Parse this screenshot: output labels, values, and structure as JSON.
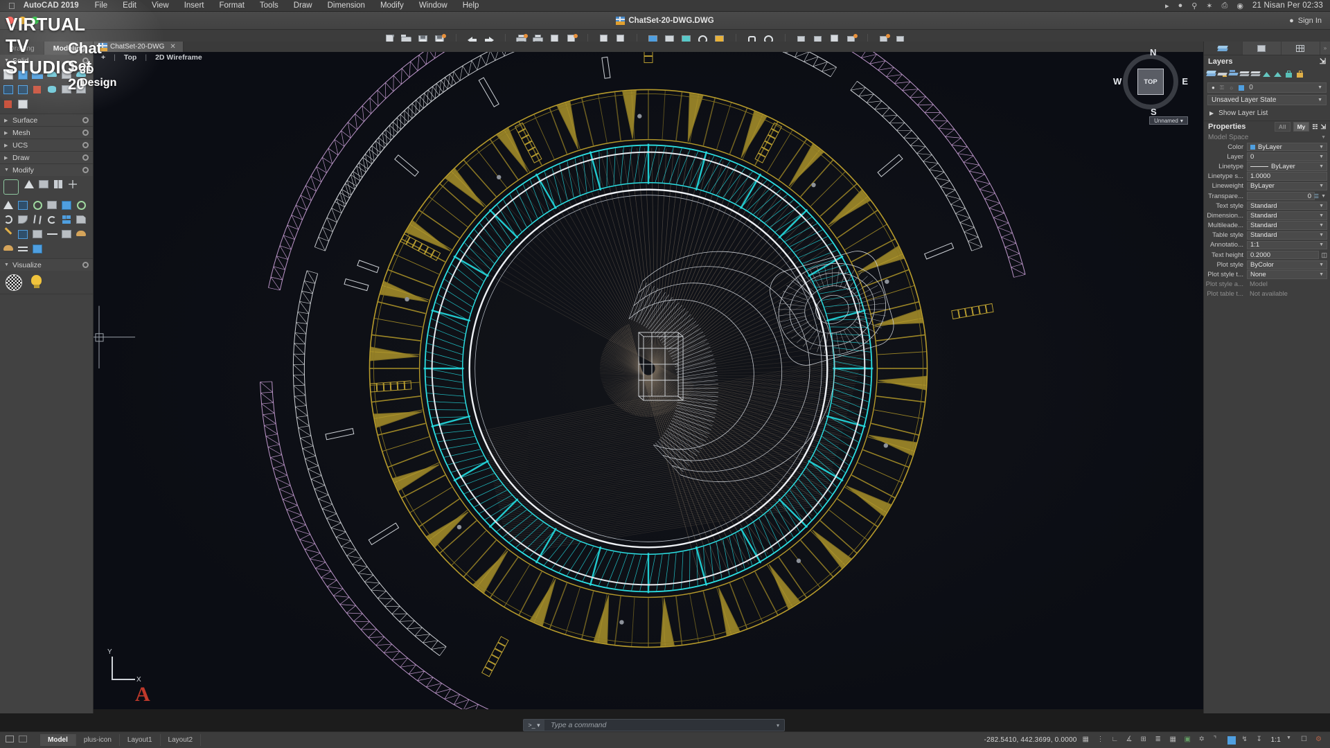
{
  "macbar": {
    "apple_icon": "apple-logo-icon",
    "app_name": "AutoCAD 2019",
    "menus": [
      "File",
      "Edit",
      "View",
      "Insert",
      "Format",
      "Tools",
      "Draw",
      "Dimension",
      "Modify",
      "Window",
      "Help"
    ],
    "status_icons": [
      "play-circle-icon",
      "tools-icon",
      "search-icon",
      "bluetooth-icon",
      "printer-icon",
      "globe-icon"
    ],
    "clock": "21 Nisan Per  02:33"
  },
  "titlebar": {
    "document_title": "ChatSet-20-DWG.DWG",
    "file_icon": "dwg-file-icon",
    "sign_in_label": "Sign In",
    "sign_in_icon": "user-icon"
  },
  "toolbar": {
    "groups": [
      {
        "name": "file",
        "buttons": [
          {
            "name": "new-drawing-button",
            "icon": "new-document-icon"
          },
          {
            "name": "open-drawing-button",
            "icon": "open-folder-icon"
          },
          {
            "name": "save-drawing-button",
            "icon": "floppy-save-icon"
          },
          {
            "name": "save-as-button",
            "icon": "floppy-save-as-icon"
          }
        ]
      },
      {
        "name": "history",
        "buttons": [
          {
            "name": "undo-button",
            "icon": "undo-arrow-icon"
          },
          {
            "name": "redo-button",
            "icon": "redo-arrow-icon"
          }
        ]
      },
      {
        "name": "plot",
        "buttons": [
          {
            "name": "plot-button",
            "icon": "printer-icon"
          },
          {
            "name": "batch-plot-button",
            "icon": "printer-transmit-icon"
          },
          {
            "name": "plot-preview-button",
            "icon": "page-preview-icon"
          },
          {
            "name": "page-setup-button",
            "icon": "page-edit-icon"
          }
        ]
      },
      {
        "name": "share",
        "buttons": [
          {
            "name": "etransmit-button",
            "icon": "transmit-page-icon"
          },
          {
            "name": "share-view-button",
            "icon": "share-page-icon"
          },
          {
            "name": "open-cloud-button",
            "icon": "cloud-page-icon"
          },
          {
            "name": "design-feed-button",
            "icon": "feed-page-icon"
          }
        ]
      },
      {
        "name": "view3d",
        "buttons": [
          {
            "name": "3d-orbit-button",
            "icon": "orbit-cube-icon"
          },
          {
            "name": "visual-style-button",
            "icon": "shaded-cube-icon"
          },
          {
            "name": "render-button",
            "icon": "render-teapot-icon"
          },
          {
            "name": "material-button",
            "icon": "material-sphere-icon"
          },
          {
            "name": "light-button",
            "icon": "light-bulb-icon"
          }
        ]
      },
      {
        "name": "navigate",
        "buttons": [
          {
            "name": "pan-button",
            "icon": "hand-pan-icon"
          },
          {
            "name": "zoom-extents-button",
            "icon": "magnifier-zoom-icon"
          }
        ]
      },
      {
        "name": "measure",
        "buttons": [
          {
            "name": "measure-button",
            "icon": "ruler-measure-icon"
          },
          {
            "name": "area-button",
            "icon": "area-icon"
          },
          {
            "name": "list-button",
            "icon": "list-properties-icon"
          },
          {
            "name": "region-button",
            "icon": "region-icon"
          }
        ]
      },
      {
        "name": "blocks",
        "buttons": [
          {
            "name": "insert-block-button",
            "icon": "insert-block-icon"
          },
          {
            "name": "block-editor-button",
            "icon": "block-editor-icon"
          }
        ]
      }
    ]
  },
  "left_palette": {
    "tabs": [
      {
        "label": "Drafting",
        "active": false
      },
      {
        "label": "Modeling",
        "active": true
      }
    ],
    "sections": [
      {
        "label": "Solid",
        "expanded": true,
        "gear_icon": "gear-icon",
        "tools": [
          {
            "name": "box-tool",
            "icon": "box-solid-icon"
          },
          {
            "name": "extrude-tool",
            "icon": "extrude-icon"
          },
          {
            "name": "presspull-tool",
            "icon": "presspull-icon"
          },
          {
            "name": "revolve-tool",
            "icon": "revolve-icon"
          },
          {
            "name": "loft-tool",
            "icon": "loft-icon"
          },
          {
            "name": "sweep-tool",
            "icon": "sweep-icon"
          },
          {
            "name": "polysolid-tool",
            "icon": "polysolid-icon"
          },
          {
            "name": "union-tool",
            "icon": "union-icon"
          },
          {
            "name": "subtract-tool",
            "icon": "subtract-icon"
          },
          {
            "name": "intersect-tool",
            "icon": "intersect-icon"
          },
          {
            "name": "slice-tool",
            "icon": "slice-icon"
          },
          {
            "name": "interfere-tool",
            "icon": "interfere-icon"
          },
          {
            "name": "solid-edit-tool",
            "icon": "solid-edit-icon"
          }
        ]
      },
      {
        "label": "Surface",
        "expanded": false,
        "gear_icon": "gear-icon",
        "tools": []
      },
      {
        "label": "Mesh",
        "expanded": false,
        "gear_icon": "gear-icon",
        "tools": []
      },
      {
        "label": "UCS",
        "expanded": false,
        "gear_icon": "gear-icon",
        "tools": []
      },
      {
        "label": "Draw",
        "expanded": false,
        "gear_icon": "gear-icon",
        "tools": []
      },
      {
        "label": "Modify",
        "expanded": true,
        "gear_icon": "gear-icon",
        "tools": [
          {
            "name": "3d-move-gizmo-tool",
            "icon": "gizmo-icon"
          },
          {
            "name": "3d-align-tool",
            "icon": "align-3d-icon"
          },
          {
            "name": "3d-array-tool",
            "icon": "array-3d-icon"
          },
          {
            "name": "3d-mirror-tool",
            "icon": "mirror-3d-icon"
          },
          {
            "name": "move-tool",
            "icon": "move-icon"
          },
          {
            "name": "taper-tool",
            "icon": "taper-icon"
          },
          {
            "name": "extract-edges-tool",
            "icon": "extract-edges-icon"
          },
          {
            "name": "rotate-3d-tool",
            "icon": "rotate-3d-icon"
          },
          {
            "name": "thicken-tool",
            "icon": "thicken-icon"
          },
          {
            "name": "shell-tool",
            "icon": "shell-icon"
          },
          {
            "name": "imprint-tool",
            "icon": "imprint-icon"
          },
          {
            "name": "round-tool",
            "icon": "round-icon"
          },
          {
            "name": "fillet-edge-tool",
            "icon": "fillet-edge-icon"
          },
          {
            "name": "trim-tool",
            "icon": "scissors-icon"
          },
          {
            "name": "offset-tool",
            "icon": "offset-icon"
          },
          {
            "name": "array-tool",
            "icon": "array-icon"
          },
          {
            "name": "chamfer-tool",
            "icon": "chamfer-icon"
          },
          {
            "name": "edit-tool",
            "icon": "pencil-icon"
          },
          {
            "name": "section-plane-tool",
            "icon": "section-plane-icon"
          },
          {
            "name": "flatshot-tool",
            "icon": "flatshot-icon"
          },
          {
            "name": "stretch-tool",
            "icon": "stretch-icon"
          },
          {
            "name": "erase-tool",
            "icon": "erase-icon"
          },
          {
            "name": "converttosurface-tool",
            "icon": "convert-surface-icon"
          },
          {
            "name": "converttosolid-tool",
            "icon": "convert-solid-icon"
          },
          {
            "name": "swap-tool",
            "icon": "swap-icon"
          },
          {
            "name": "separate-tool",
            "icon": "separate-icon"
          }
        ]
      },
      {
        "label": "Visualize",
        "expanded": true,
        "gear_icon": "gear-icon",
        "tools": [
          {
            "name": "render-tool",
            "icon": "checker-sphere-icon"
          },
          {
            "name": "light-tool",
            "icon": "light-bulb-icon"
          }
        ]
      }
    ]
  },
  "viewport": {
    "tab_label": "ChatSet-20-DWG",
    "tab_icon": "dwg-file-icon",
    "tab_close_icon": "close-icon",
    "controls": {
      "viewport_menu": "+",
      "view_name": "Top",
      "visual_style": "2D Wireframe"
    },
    "viewcube": {
      "face_label": "TOP",
      "north": "N",
      "south": "S",
      "east": "E",
      "west": "W",
      "named_view": "Unnamed"
    },
    "ucs_icon": {
      "label_x": "X",
      "label_y": "Y"
    },
    "acad_logo": "A"
  },
  "command_line": {
    "prompt_icon": "command-prompt-icon",
    "placeholder": "Type a command",
    "value": "",
    "dropdown_icon": "chevron-down-icon"
  },
  "right_panel": {
    "tabs": [
      {
        "name": "layers-tab",
        "icon": "layers-stack-icon",
        "active": true
      },
      {
        "name": "blocks-tab",
        "icon": "block-icon",
        "active": false
      },
      {
        "name": "tables-tab",
        "icon": "grid-table-icon",
        "active": false
      }
    ],
    "tab_close_icon": "close-panel-icon",
    "layers": {
      "title": "Layers",
      "undock_icon": "undock-icon",
      "tool_icons": [
        "layer-properties-icon",
        "layer-new-icon",
        "layer-previous-icon",
        "layer-merge-icon",
        "layer-match-icon",
        "layer-isolate-icon",
        "layer-unisolate-icon",
        "layer-lock-icon",
        "layer-unlock-icon"
      ],
      "current_layer": {
        "on_icon": "lightbulb-on-icon",
        "lock_icon": "unlock-icon",
        "freeze_icon": "sun-icon",
        "color_swatch": "#4f9fe0",
        "name": "0"
      },
      "layer_state": "Unsaved Layer State",
      "show_layer_list": "Show Layer List",
      "expand_icon": "chevron-right-icon"
    },
    "properties": {
      "title": "Properties",
      "filter_all": "All",
      "filter_my": "My",
      "quick_select_icon": "quick-select-icon",
      "undock_icon": "undock-icon",
      "context": "Model Space",
      "rows": [
        {
          "label": "Color",
          "value": "ByLayer",
          "type": "color",
          "swatch": "#4f9fe0"
        },
        {
          "label": "Layer",
          "value": "0",
          "type": "select"
        },
        {
          "label": "Linetype",
          "value": "ByLayer",
          "type": "linetype"
        },
        {
          "label": "Linetype s...",
          "value": "1.0000",
          "type": "text"
        },
        {
          "label": "Lineweight",
          "value": "ByLayer",
          "type": "select"
        },
        {
          "label": "Transpare...",
          "value": "0",
          "type": "slider"
        },
        {
          "label": "Text style",
          "value": "Standard",
          "type": "select"
        },
        {
          "label": "Dimension...",
          "value": "Standard",
          "type": "select"
        },
        {
          "label": "Multileade...",
          "value": "Standard",
          "type": "select"
        },
        {
          "label": "Table style",
          "value": "Standard",
          "type": "select"
        },
        {
          "label": "Annotatio...",
          "value": "1:1",
          "type": "select"
        },
        {
          "label": "Text height",
          "value": "0.2000",
          "type": "textbtn"
        },
        {
          "label": "Plot style",
          "value": "ByColor",
          "type": "select"
        },
        {
          "label": "Plot style t...",
          "value": "None",
          "type": "select"
        },
        {
          "label": "Plot style a...",
          "value": "Model",
          "type": "readonly"
        },
        {
          "label": "Plot table t...",
          "value": "Not available",
          "type": "readonly"
        }
      ]
    }
  },
  "status_bar": {
    "model_tab": "Model",
    "add_layout_icon": "plus-icon",
    "layout_tabs": [
      "Layout1",
      "Layout2"
    ],
    "coordinates": "-282.5410, 442.3699, 0.0000",
    "annotation_scale": "1:1",
    "toggles": [
      {
        "name": "grid-toggle",
        "icon": "grid-icon",
        "on": false
      },
      {
        "name": "snap-toggle",
        "icon": "snap-dots-icon",
        "on": false
      },
      {
        "name": "ortho-toggle",
        "icon": "ortho-icon",
        "on": false
      },
      {
        "name": "polar-toggle",
        "icon": "polar-icon",
        "on": false
      },
      {
        "name": "osnap-toggle",
        "icon": "osnap-icon",
        "on": false
      },
      {
        "name": "otrack-toggle",
        "icon": "otrack-icon",
        "on": false
      },
      {
        "name": "lineweight-toggle",
        "icon": "lineweight-icon",
        "on": false
      },
      {
        "name": "transparency-toggle",
        "icon": "transparency-icon",
        "on": false
      },
      {
        "name": "selection-cycling-toggle",
        "icon": "selection-cycle-icon",
        "on": false
      },
      {
        "name": "dynamic-ucs-toggle",
        "icon": "dynamic-ucs-icon",
        "on": false
      },
      {
        "name": "annotation-visibility-toggle",
        "icon": "annotation-eye-icon",
        "on": true
      },
      {
        "name": "autoscale-toggle",
        "icon": "autoscale-icon",
        "on": false
      },
      {
        "name": "workspace-toggle",
        "icon": "workspace-icon",
        "on": false
      },
      {
        "name": "cleanscreen-toggle",
        "icon": "clean-screen-icon",
        "on": false
      },
      {
        "name": "customization-toggle",
        "icon": "customization-gear-icon",
        "on": false
      }
    ]
  },
  "watermark": {
    "line1": "VIRTUAL TV STUDIO",
    "line2": "Chat Set 20",
    "line3": "3D Design"
  },
  "drawing": {
    "description": "Top view wireframe of a circular virtual TV studio set",
    "colors": {
      "outer_truss": "#c49fd0",
      "white_truss": "#d8dbe0",
      "radial_spokes": "#a08a2a",
      "cyan_ring": "#22d3d8",
      "inner_circle": "#e8eaee",
      "furniture": "#cfd2d8",
      "floor_sweep": "#8a7a68",
      "background": "#0b0d14"
    }
  }
}
